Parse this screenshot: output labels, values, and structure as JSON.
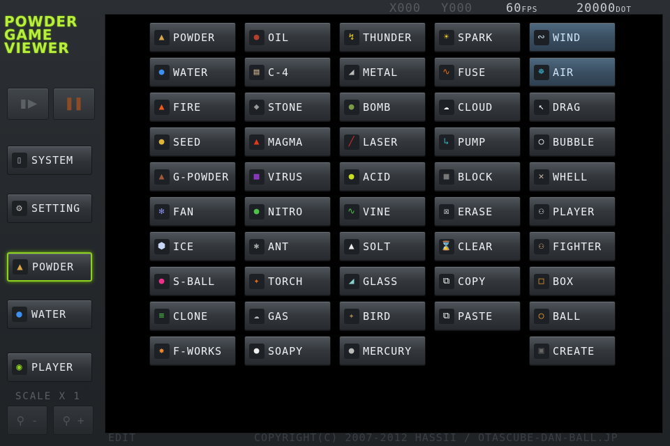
{
  "logo": [
    "POWDER",
    "GAME",
    "VIEWER"
  ],
  "controls": {
    "play_icon": "play-step-icon",
    "pause_icon": "pause-icon"
  },
  "side": {
    "system": "SYSTEM",
    "setting": "SETTING",
    "powder": "POWDER",
    "water": "WATER",
    "player": "PLAYER",
    "scale": "SCALE X 1"
  },
  "status": {
    "x": "X000",
    "y": "Y000",
    "fps": "60",
    "fps_unit": "FPS",
    "dot": "20000",
    "dot_unit": "DOT"
  },
  "grid": {
    "col0": [
      "POWDER",
      "WATER",
      "FIRE",
      "SEED",
      "G-POWDER",
      "FAN",
      "ICE",
      "S-BALL",
      "CLONE",
      "F-WORKS"
    ],
    "col1": [
      "OIL",
      "C-4",
      "STONE",
      "MAGMA",
      "VIRUS",
      "NITRO",
      "ANT",
      "TORCH",
      "GAS",
      "SOAPY"
    ],
    "col2": [
      "THUNDER",
      "METAL",
      "BOMB",
      "LASER",
      "ACID",
      "VINE",
      "SOLT",
      "GLASS",
      "BIRD",
      "MERCURY"
    ],
    "col3": [
      "SPARK",
      "FUSE",
      "CLOUD",
      "PUMP",
      "BLOCK",
      "ERASE",
      "CLEAR",
      "COPY",
      "PASTE"
    ],
    "col4": [
      "WIND",
      "AIR",
      "DRAG",
      "BUBBLE",
      "WHELL",
      "PLAYER",
      "FIGHTER",
      "BOX",
      "BALL",
      "CREATE"
    ]
  },
  "footer": {
    "edit": "EDIT",
    "copyright": "COPYRIGHT(C) 2007-2012 HASSII / OTASCUBE-DAN-BALL.JP"
  },
  "colors": {
    "logo": "#b7ef3a",
    "active_border": "#8fd11f",
    "highlight": "#3a4f62"
  }
}
